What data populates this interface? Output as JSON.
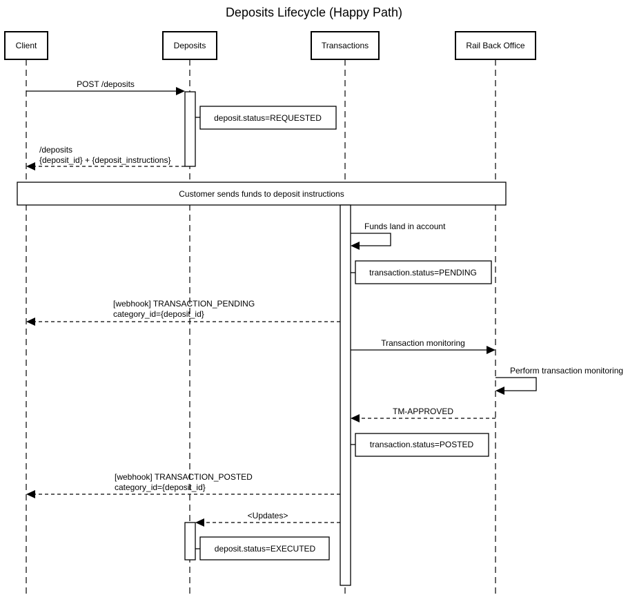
{
  "diagram": {
    "title": "Deposits Lifecycle (Happy Path)",
    "participants": [
      {
        "id": "client",
        "label": "Client"
      },
      {
        "id": "deposits",
        "label": "Deposits"
      },
      {
        "id": "transactions",
        "label": "Transactions"
      },
      {
        "id": "rbo",
        "label": "Rail Back Office"
      }
    ],
    "messages": [
      {
        "id": "m1",
        "from": "client",
        "to": "deposits",
        "style": "solid",
        "lines": [
          "POST /deposits"
        ]
      },
      {
        "id": "m2",
        "from": "deposits",
        "to": "client",
        "style": "dashed",
        "lines": [
          "/deposits",
          "{deposit_id} + {deposit_instructions}"
        ]
      },
      {
        "id": "m3",
        "from": "transactions",
        "to": "transactions",
        "style": "solid",
        "lines": [
          "Funds land in account"
        ]
      },
      {
        "id": "m4",
        "from": "transactions",
        "to": "client",
        "style": "dashed",
        "lines": [
          "[webhook] TRANSACTION_PENDING",
          "category_id={deposit_id}"
        ]
      },
      {
        "id": "m5",
        "from": "transactions",
        "to": "rbo",
        "style": "solid",
        "lines": [
          "Transaction monitoring"
        ]
      },
      {
        "id": "m6",
        "from": "rbo",
        "to": "rbo",
        "style": "solid",
        "lines": [
          "Perform transaction monitoring"
        ]
      },
      {
        "id": "m7",
        "from": "rbo",
        "to": "transactions",
        "style": "dashed",
        "lines": [
          "TM-APPROVED"
        ]
      },
      {
        "id": "m8",
        "from": "transactions",
        "to": "client",
        "style": "dashed",
        "lines": [
          "[webhook] TRANSACTION_POSTED",
          "category_id={deposit_id}"
        ]
      },
      {
        "id": "m9",
        "from": "transactions",
        "to": "deposits",
        "style": "dashed",
        "lines": [
          "<Updates>"
        ]
      }
    ],
    "notes": [
      {
        "id": "n1",
        "attached_to": "deposits",
        "text": "deposit.status=REQUESTED"
      },
      {
        "id": "n2",
        "attached_to": "transactions",
        "text": "transaction.status=PENDING"
      },
      {
        "id": "n3",
        "attached_to": "transactions",
        "text": "transaction.status=POSTED"
      },
      {
        "id": "n4",
        "attached_to": "deposits",
        "text": "deposit.status=EXECUTED"
      }
    ],
    "divider": {
      "text": "Customer sends funds to deposit instructions"
    }
  }
}
